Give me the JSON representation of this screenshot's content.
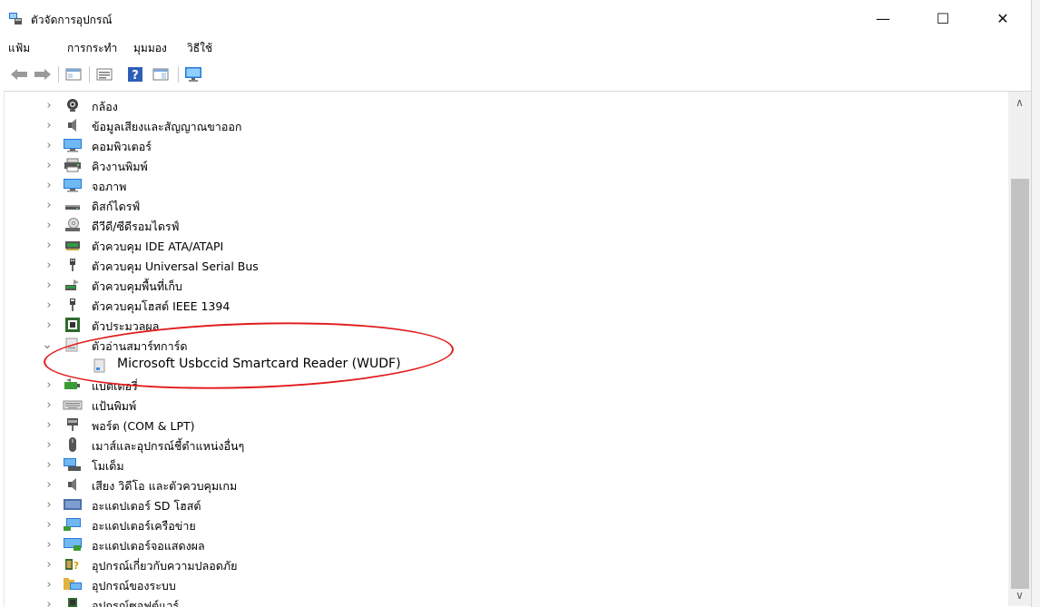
{
  "window": {
    "title": "ตัวจัดการอุปกรณ์",
    "minimize": "—",
    "maximize": "☐",
    "close": "✕"
  },
  "menu": [
    "แฟ้ม",
    "การกระทำ",
    "มุมมอง",
    "วิธีใช้"
  ],
  "toolbar": [
    {
      "name": "back-arrow-icon",
      "glyph": "⇦"
    },
    {
      "name": "forward-arrow-icon",
      "glyph": "⇨"
    },
    {
      "name": "show-hide-tree-icon",
      "glyph": ""
    },
    {
      "name": "properties-icon",
      "glyph": ""
    },
    {
      "name": "help-icon",
      "glyph": "?"
    },
    {
      "name": "action-pane-icon",
      "glyph": ""
    },
    {
      "name": "monitor-icon",
      "glyph": ""
    }
  ],
  "tree": [
    {
      "label": "กล้อง",
      "icon": "camera-icon",
      "expanded": false
    },
    {
      "label": "ข้อมูลเสียงและสัญญาณขาออก",
      "icon": "speaker-icon",
      "expanded": false
    },
    {
      "label": "คอมพิวเตอร์",
      "icon": "computer-icon",
      "expanded": false
    },
    {
      "label": "คิวงานพิมพ์",
      "icon": "print-queue-icon",
      "expanded": false
    },
    {
      "label": "จอภาพ",
      "icon": "monitor-icon",
      "expanded": false
    },
    {
      "label": "ดิสก์ไดรฟ์",
      "icon": "disk-drive-icon",
      "expanded": false
    },
    {
      "label": "ดีวีดี/ซีดีรอมไดรฟ์",
      "icon": "dvd-drive-icon",
      "expanded": false
    },
    {
      "label": "ตัวควบคุม IDE ATA/ATAPI",
      "icon": "ide-controller-icon",
      "expanded": false
    },
    {
      "label": "ตัวควบคุม Universal Serial Bus",
      "icon": "usb-icon",
      "expanded": false
    },
    {
      "label": "ตัวควบคุมพื้นที่เก็บ",
      "icon": "storage-controller-icon",
      "expanded": false
    },
    {
      "label": "ตัวควบคุมโฮสต์ IEEE 1394",
      "icon": "ieee1394-icon",
      "expanded": false
    },
    {
      "label": "ตัวประมวลผล",
      "icon": "processor-icon",
      "expanded": false
    },
    {
      "label": "ตัวอ่านสมาร์ทการ์ด",
      "icon": "smartcard-reader-icon",
      "expanded": true,
      "children": [
        {
          "label": "Microsoft Usbccid Smartcard Reader (WUDF)",
          "icon": "smartcard-device-icon"
        }
      ]
    },
    {
      "label": "แบตเตอรี่",
      "icon": "battery-icon",
      "expanded": false
    },
    {
      "label": "แป้นพิมพ์",
      "icon": "keyboard-icon",
      "expanded": false
    },
    {
      "label": "พอร์ต (COM & LPT)",
      "icon": "port-icon",
      "expanded": false
    },
    {
      "label": "เมาส์และอุปกรณ์ชี้ตำแหน่งอื่นๆ",
      "icon": "mouse-icon",
      "expanded": false
    },
    {
      "label": "โมเด็ม",
      "icon": "modem-icon",
      "expanded": false
    },
    {
      "label": "เสียง วิดีโอ และตัวควบคุมเกม",
      "icon": "sound-video-icon",
      "expanded": false
    },
    {
      "label": "อะแดปเตอร์ SD โฮสต์",
      "icon": "sd-host-icon",
      "expanded": false
    },
    {
      "label": "อะแดปเตอร์เครือข่าย",
      "icon": "network-adapter-icon",
      "expanded": false
    },
    {
      "label": "อะแดปเตอร์จอแสดงผล",
      "icon": "display-adapter-icon",
      "expanded": false
    },
    {
      "label": "อุปกรณ์เกี่ยวกับความปลอดภัย",
      "icon": "security-device-icon",
      "expanded": false
    },
    {
      "label": "อุปกรณ์ของระบบ",
      "icon": "system-device-icon",
      "expanded": false
    },
    {
      "label": "อุปกรณ์ซอฟต์แวร์",
      "icon": "software-device-icon",
      "expanded": false
    }
  ],
  "colors": {
    "annotation": "#e21b1b",
    "accent": "#2a78d6"
  }
}
